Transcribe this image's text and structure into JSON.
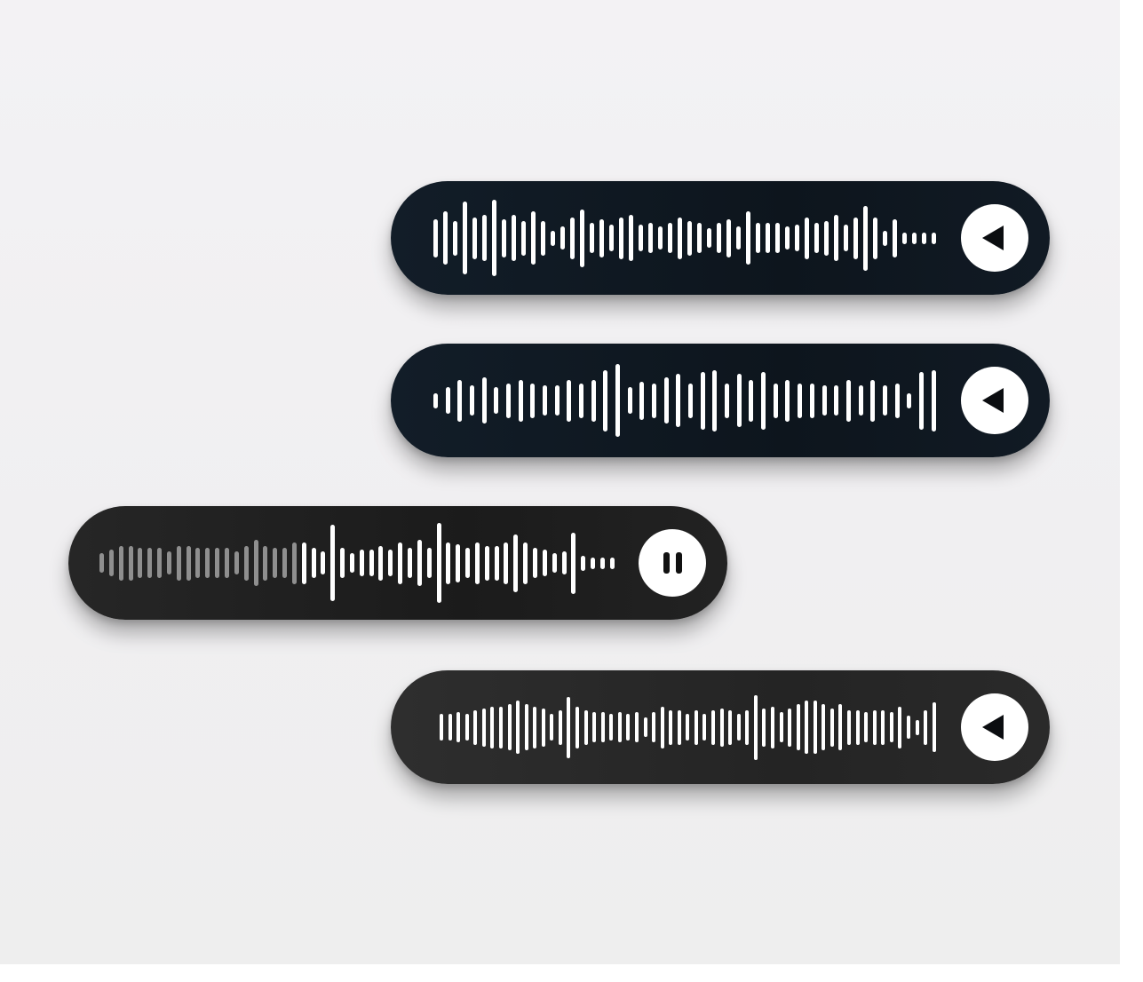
{
  "colors": {
    "background": "#f1f0f2",
    "bubble_navy": "#0f1720",
    "bubble_charcoal": "#1e1e1e",
    "bubble_dark_gray": "#272727",
    "waveform": "#ffffff",
    "waveform_played": "#8f8f8f",
    "button": "#ffffff"
  },
  "messages": [
    {
      "button_icon": "play-icon",
      "waveform": {
        "bar_heights": [
          0.5,
          0.7,
          0.45,
          0.95,
          0.55,
          0.6,
          1.0,
          0.5,
          0.6,
          0.45,
          0.7,
          0.45,
          0.2,
          0.3,
          0.55,
          0.75,
          0.4,
          0.5,
          0.35,
          0.55,
          0.6,
          0.35,
          0.4,
          0.3,
          0.4,
          0.55,
          0.45,
          0.4,
          0.25,
          0.4,
          0.5,
          0.3,
          0.7,
          0.4,
          0.4,
          0.4,
          0.3,
          0.35,
          0.55,
          0.4,
          0.45,
          0.6,
          0.35,
          0.55,
          0.85,
          0.55,
          0.2,
          0.5,
          0.15,
          0.15,
          0.15,
          0.15
        ]
      }
    },
    {
      "button_icon": "play-icon",
      "waveform": {
        "bar_heights": [
          0.2,
          0.35,
          0.55,
          0.4,
          0.6,
          0.35,
          0.45,
          0.55,
          0.45,
          0.4,
          0.4,
          0.55,
          0.45,
          0.55,
          0.8,
          0.95,
          0.35,
          0.5,
          0.45,
          0.6,
          0.7,
          0.45,
          0.75,
          0.8,
          0.45,
          0.7,
          0.55,
          0.75,
          0.45,
          0.55,
          0.45,
          0.45,
          0.4,
          0.4,
          0.55,
          0.4,
          0.55,
          0.4,
          0.45,
          0.2,
          0.75,
          0.8
        ]
      }
    },
    {
      "button_icon": "pause-icon",
      "waveform": {
        "played_count": 21,
        "bar_heights": [
          0.25,
          0.35,
          0.45,
          0.45,
          0.4,
          0.4,
          0.4,
          0.3,
          0.45,
          0.45,
          0.4,
          0.4,
          0.4,
          0.4,
          0.3,
          0.45,
          0.6,
          0.45,
          0.4,
          0.4,
          0.55,
          0.55,
          0.4,
          0.3,
          1.0,
          0.4,
          0.25,
          0.35,
          0.35,
          0.45,
          0.35,
          0.55,
          0.4,
          0.6,
          0.4,
          1.05,
          0.55,
          0.5,
          0.4,
          0.55,
          0.45,
          0.45,
          0.55,
          0.75,
          0.55,
          0.4,
          0.35,
          0.25,
          0.3,
          0.8,
          0.2,
          0.15,
          0.15,
          0.15
        ]
      }
    },
    {
      "button_icon": "play-icon",
      "waveform": {
        "bar_heights": [
          0.35,
          0.35,
          0.4,
          0.35,
          0.45,
          0.5,
          0.55,
          0.55,
          0.6,
          0.7,
          0.6,
          0.55,
          0.5,
          0.35,
          0.45,
          0.8,
          0.55,
          0.45,
          0.4,
          0.4,
          0.35,
          0.4,
          0.35,
          0.4,
          0.25,
          0.4,
          0.55,
          0.45,
          0.45,
          0.35,
          0.45,
          0.35,
          0.45,
          0.5,
          0.45,
          0.35,
          0.45,
          0.85,
          0.5,
          0.55,
          0.4,
          0.5,
          0.6,
          0.7,
          0.7,
          0.6,
          0.5,
          0.6,
          0.45,
          0.45,
          0.4,
          0.45,
          0.45,
          0.4,
          0.55,
          0.3,
          0.2,
          0.45,
          0.65
        ]
      }
    }
  ]
}
